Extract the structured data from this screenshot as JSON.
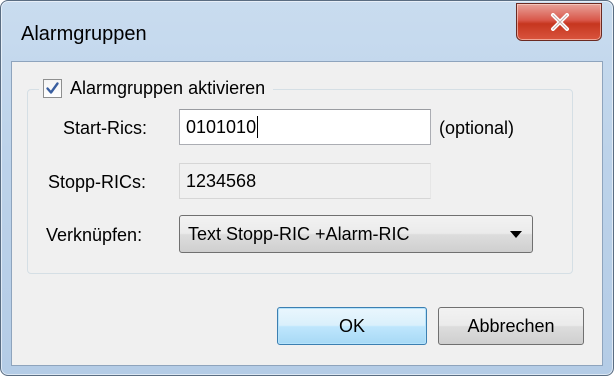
{
  "window": {
    "title": "Alarmgruppen"
  },
  "group": {
    "checkbox_label": "Alarmgruppen aktivieren",
    "checkbox_checked": true
  },
  "fields": {
    "start_rics_label": "Start-Rics:",
    "start_rics_value": "0101010",
    "start_rics_hint": "(optional)",
    "stopp_rics_label": "Stopp-RICs:",
    "stopp_rics_value": "1234568",
    "verknuepfen_label": "Verknüpfen:",
    "verknuepfen_value": "Text Stopp-RIC +Alarm-RIC"
  },
  "buttons": {
    "ok_label": "OK",
    "cancel_label": "Abbrechen"
  },
  "icons": {
    "close": "close-icon",
    "check": "checkmark-icon",
    "dropdown": "chevron-down-icon"
  }
}
